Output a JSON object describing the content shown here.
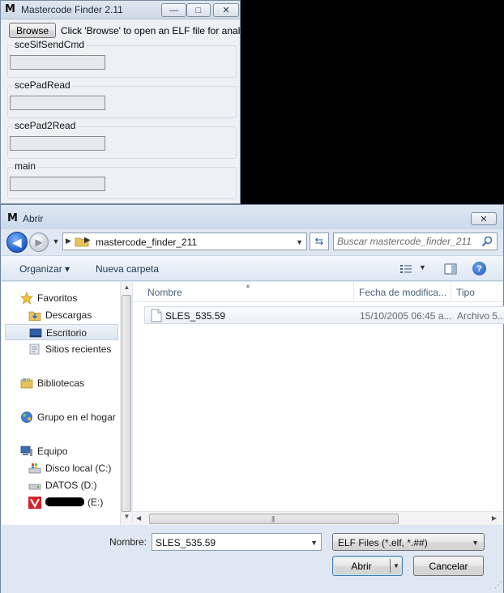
{
  "app_window": {
    "title": "Mastercode Finder 2.11",
    "logo_text": "M",
    "caption_buttons": {
      "minimize": "—",
      "maximize": "□",
      "close": "✕"
    },
    "browse_label": "Browse",
    "hint": "Click 'Browse' to open an ELF file for analysis",
    "groups": [
      {
        "label": "sceSifSendCmd",
        "value": ""
      },
      {
        "label": "scePadRead",
        "value": ""
      },
      {
        "label": "scePad2Read",
        "value": ""
      },
      {
        "label": "main",
        "value": ""
      }
    ]
  },
  "dialog": {
    "title": "Abrir",
    "logo_text": "M",
    "close_glyph": "✕",
    "nav": {
      "back_glyph": "◀",
      "forward_glyph": "▶"
    },
    "address": {
      "path": "mastercode_finder_211",
      "separator": "▶"
    },
    "search": {
      "placeholder": "Buscar mastercode_finder_211"
    },
    "toolbar": {
      "organize": "Organizar ▾",
      "new_folder": "Nueva carpeta",
      "help": "?"
    },
    "nav_pane": {
      "favorites": "Favoritos",
      "downloads": "Descargas",
      "desktop": "Escritorio",
      "recent": "Sitios recientes",
      "libraries": "Bibliotecas",
      "homegroup": "Grupo en el hogar",
      "computer": "Equipo",
      "drive_c": "Disco local (C:)",
      "drive_d": "DATOS (D:)",
      "drive_e_suffix": "(E:)"
    },
    "columns": {
      "name": "Nombre",
      "date": "Fecha de modifica...",
      "type": "Tipo"
    },
    "files": [
      {
        "name": "SLES_535.59",
        "date": "15/10/2005 06:45 a...",
        "type": "Archivo 5..."
      }
    ],
    "filename_label": "Nombre:",
    "filename_value": "SLES_535.59",
    "filter": "ELF Files (*.elf, *.##)",
    "open_label": "Abrir",
    "cancel_label": "Cancelar"
  },
  "icons": {
    "folder": "folder-icon",
    "star": "star-icon",
    "desktop": "desktop-icon",
    "file": "file-icon",
    "search": "search-icon",
    "refresh": "refresh-icon"
  },
  "colors": {
    "accent": "#1e5bc6",
    "link": "#1d3453",
    "drive_e_brand": "#d8202b"
  }
}
